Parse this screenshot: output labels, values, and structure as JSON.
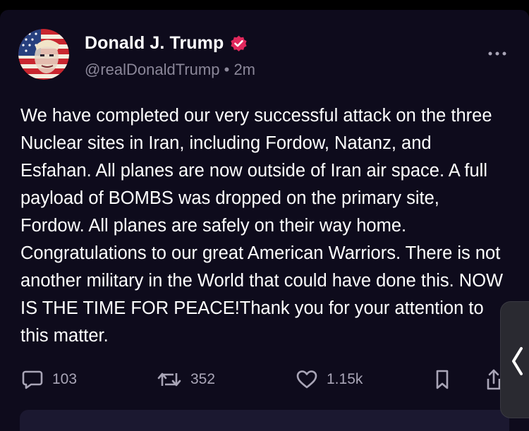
{
  "post": {
    "author_name": "Donald J. Trump",
    "handle": "@realDonaldTrump",
    "separator": "•",
    "time": "2m",
    "text": "We have completed our very successful attack on the three Nuclear sites in Iran, including Fordow, Natanz, and Esfahan. All planes are now outside of Iran air space. A full payload of BOMBS was dropped on the primary site, Fordow. All planes are safely on their way home. Congratulations to our great American Warriors. There is not another military in the World that could have done this. NOW IS THE TIME FOR PEACE!Thank you for your attention to this matter."
  },
  "actions": {
    "replies": "103",
    "reposts": "352",
    "likes": "1.15k"
  },
  "icons": {
    "reply": "reply-icon",
    "repost": "repost-icon",
    "like": "heart-icon",
    "bookmark": "bookmark-icon",
    "share": "share-icon",
    "more": "more-icon",
    "verified": "verified-badge-icon",
    "side": "chevron-left-icon"
  },
  "colors": {
    "background": "#0e0b1c",
    "verified": "#e0285c",
    "text": "#ffffff",
    "muted": "#8b8799"
  }
}
